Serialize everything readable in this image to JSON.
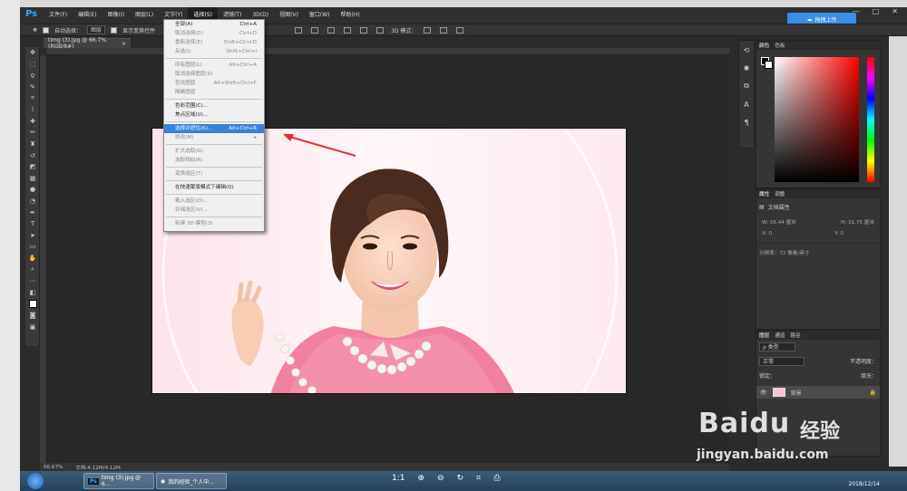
{
  "app": {
    "logo": "Ps"
  },
  "menubar": {
    "items": [
      "文件(F)",
      "编辑(E)",
      "图像(I)",
      "图层(L)",
      "文字(Y)",
      "选择(S)",
      "滤镜(T)",
      "3D(D)",
      "视图(V)",
      "窗口(W)",
      "帮助(H)"
    ],
    "active_index": 5
  },
  "window_controls": {
    "minimize": "—",
    "maximize": "□",
    "close": "✕"
  },
  "baidu_upload": {
    "label": "拖拽上传",
    "icon": "cloud-icon"
  },
  "options_bar": {
    "auto_select_label": "自动选择：",
    "auto_select_value": "图层",
    "show_transform_label": "显示变换控件",
    "mode_3d": "3D 模式："
  },
  "document": {
    "tab_title": "timg (3).jpg @ 66.7%(RGB/8#)",
    "close": "×"
  },
  "dropdown": {
    "items": [
      {
        "label": "全部(A)",
        "shortcut": "Ctrl+A",
        "state": "normal"
      },
      {
        "label": "取消选择(D)",
        "shortcut": "Ctrl+D",
        "state": "dim"
      },
      {
        "label": "重新选择(E)",
        "shortcut": "Shift+Ctrl+D",
        "state": "dim"
      },
      {
        "label": "反选(I)",
        "shortcut": "Shift+Ctrl+I",
        "state": "dim"
      },
      {
        "sep": true
      },
      {
        "label": "所有图层(L)",
        "shortcut": "Alt+Ctrl+A",
        "state": "dim"
      },
      {
        "label": "取消选择图层(S)",
        "shortcut": "",
        "state": "dim"
      },
      {
        "label": "查找图层",
        "shortcut": "Alt+Shift+Ctrl+F",
        "state": "dim"
      },
      {
        "label": "隔离图层",
        "shortcut": "",
        "state": "dim"
      },
      {
        "sep": true
      },
      {
        "label": "色彩范围(C)...",
        "shortcut": "",
        "state": "normal"
      },
      {
        "label": "焦点区域(U)...",
        "shortcut": "",
        "state": "normal"
      },
      {
        "sep": true
      },
      {
        "label": "选择并遮住(K)...",
        "shortcut": "Alt+Ctrl+R",
        "state": "hl"
      },
      {
        "label": "修改(M)",
        "shortcut": "▸",
        "state": "dim"
      },
      {
        "sep": true
      },
      {
        "label": "扩大选取(G)",
        "shortcut": "",
        "state": "dim"
      },
      {
        "label": "选取相似(R)",
        "shortcut": "",
        "state": "dim"
      },
      {
        "sep": true
      },
      {
        "label": "变换选区(T)",
        "shortcut": "",
        "state": "dim"
      },
      {
        "sep": true
      },
      {
        "label": "在快速蒙版模式下编辑(Q)",
        "shortcut": "",
        "state": "normal"
      },
      {
        "sep": true
      },
      {
        "label": "载入选区(O)...",
        "shortcut": "",
        "state": "dim"
      },
      {
        "label": "存储选区(V)...",
        "shortcut": "",
        "state": "dim"
      },
      {
        "sep": true
      },
      {
        "label": "新建 3D 模型(3)",
        "shortcut": "",
        "state": "dim"
      }
    ]
  },
  "color_panel": {
    "tabs": [
      "颜色",
      "色板"
    ]
  },
  "properties_panel": {
    "tabs": [
      "属性",
      "调整"
    ],
    "title": "文档属性",
    "w": "W: 56.44 厘米",
    "h": "H: 31.75 厘米",
    "x": "X: 0",
    "y": "Y: 0",
    "resolution": "分辨率：72 像素/英寸"
  },
  "layers_panel": {
    "tabs": [
      "图层",
      "通道",
      "路径"
    ],
    "kind": "ρ 类型",
    "blend": "正常",
    "opacity": "不透明度：",
    "lock": "锁定：",
    "fill": "填充：",
    "layer_name": "背景"
  },
  "status": {
    "zoom": "66.67%",
    "doc": "文档:4.12M/4.12M"
  },
  "taskbar": {
    "tasks": [
      {
        "label": "timg (3).jpg @ 6..."
      },
      {
        "label": "我的经验_个人中..."
      }
    ],
    "date": "2018/12/14"
  },
  "watermark": {
    "brand": "Baidu",
    "brand2": "经验",
    "url": "jingyan.baidu.com"
  },
  "colors": {
    "accent": "#3c7fd6",
    "ps_blue": "#31a8ff",
    "arrow": "#e03030"
  }
}
